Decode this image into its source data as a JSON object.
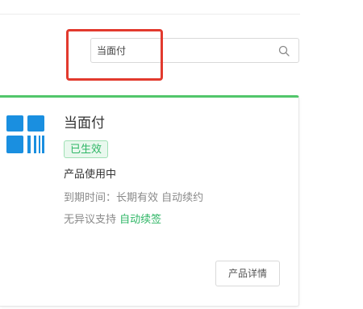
{
  "search": {
    "value": "当面付"
  },
  "product": {
    "name": "当面付",
    "status": "已生效",
    "usage": "产品使用中",
    "expiry_text": "到期时间：长期有效 自动续约",
    "support_prefix": "无异议支持",
    "support_link": "自动续签",
    "detail_button": "产品详情",
    "logo_icon": "alipay-face-to-face-icon"
  },
  "colors": {
    "accent_green": "#52c66b",
    "badge_text": "#2eb665",
    "logo_blue": "#1a8fe0",
    "highlight_red": "#e23a2e"
  }
}
